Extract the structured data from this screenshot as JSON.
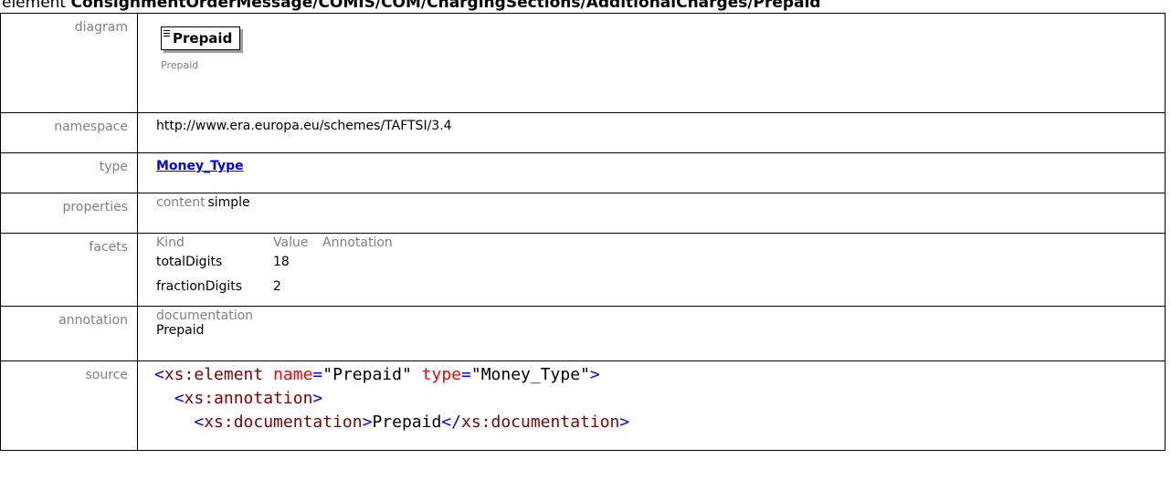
{
  "header": {
    "prefix": "element",
    "path": "ConsignmentOrderMessage/COMIS/COM/ChargingSections/AdditionalCharges/Prepaid"
  },
  "labels": {
    "diagram": "diagram",
    "namespace": "namespace",
    "type": "type",
    "properties": "properties",
    "facets": "facets",
    "annotation": "annotation",
    "source": "source"
  },
  "diagram": {
    "element_name": "Prepaid",
    "caption": "Prepaid"
  },
  "namespace": "http://www.era.europa.eu/schemes/TAFTSI/3.4",
  "type": {
    "name": "Money_Type"
  },
  "properties": {
    "key": "content",
    "value": "simple"
  },
  "facets": {
    "headers": [
      "Kind",
      "Value",
      "Annotation"
    ],
    "rows": [
      {
        "kind": "totalDigits",
        "value": "18"
      },
      {
        "kind": "fractionDigits",
        "value": "2"
      }
    ]
  },
  "annotation": {
    "heading": "documentation",
    "text": "Prepaid"
  },
  "source": {
    "line1": {
      "open": "<",
      "tag": "xs:element",
      "attr1": "name",
      "eq1": "=",
      "val1": "\"Prepaid\"",
      "attr2": "type",
      "eq2": "=",
      "val2": "\"Money_Type\"",
      "close": ">"
    },
    "line2": {
      "open": "<",
      "tag": "xs:annotation",
      "close": ">"
    },
    "line3": {
      "open": "<",
      "tag": "xs:documentation",
      "close": ">",
      "text": "Prepaid",
      "endopen": "</",
      "endtag": "xs:documentation",
      "endclose": ">"
    }
  }
}
